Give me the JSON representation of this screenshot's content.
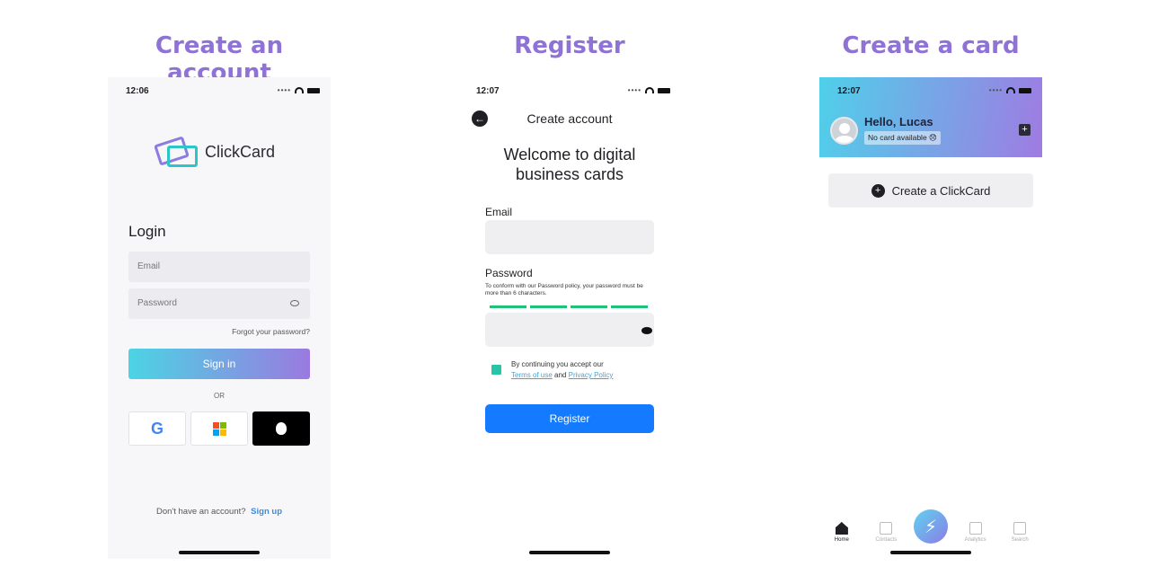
{
  "panels": {
    "login_title": "Create an account",
    "register_title": "Register",
    "card_title": "Create a card"
  },
  "login_screen": {
    "time": "12:06",
    "brand": "ClickCard",
    "heading": "Login",
    "email_placeholder": "Email",
    "password_placeholder": "Password",
    "forgot": "Forgot your password?",
    "sign_in": "Sign in",
    "or": "OR",
    "social_google_letter": "G",
    "no_account": "Don't have an account?",
    "sign_up": "Sign up",
    "ms_colors": [
      "#f25022",
      "#7fba00",
      "#00a4ef",
      "#ffb900"
    ]
  },
  "register_screen": {
    "time": "12:07",
    "header": "Create account",
    "welcome": "Welcome to digital business cards",
    "email_label": "Email",
    "password_label": "Password",
    "policy": "To conform with our Password policy, your password must be more than 6 characters.",
    "terms_prefix": "By continuing you accept our",
    "terms_link": "Terms of use",
    "terms_and": "and",
    "privacy_link": "Privacy Policy",
    "register_button": "Register",
    "strength_color": "#21c178",
    "button_color": "#147aff"
  },
  "card_screen": {
    "time": "12:07",
    "greeting": "Hello, Lucas",
    "no_card": "No card available 😞",
    "create_button": "Create a ClickCard",
    "tabs": [
      {
        "label": "Home"
      },
      {
        "label": "Contacts"
      },
      {
        "label": "Analytics"
      },
      {
        "label": "Search"
      }
    ]
  }
}
